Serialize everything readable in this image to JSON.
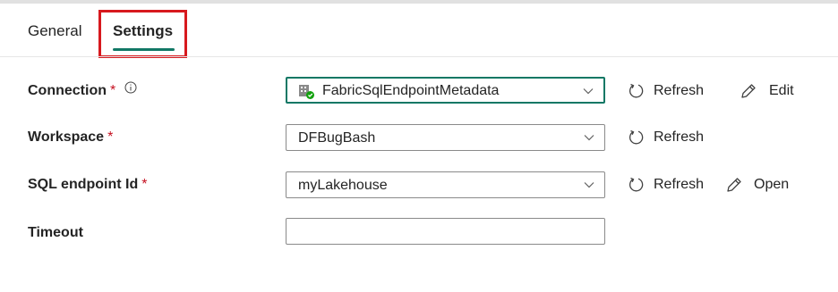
{
  "tabs": {
    "general": "General",
    "settings": "Settings"
  },
  "form": {
    "connection": {
      "label": "Connection",
      "required_mark": "*",
      "value": "FabricSqlEndpointMetadata",
      "refresh": "Refresh",
      "edit": "Edit"
    },
    "workspace": {
      "label": "Workspace",
      "required_mark": "*",
      "value": "DFBugBash",
      "refresh": "Refresh"
    },
    "sql_endpoint": {
      "label": "SQL endpoint Id",
      "required_mark": "*",
      "value": "myLakehouse",
      "refresh": "Refresh",
      "open": "Open"
    },
    "timeout": {
      "label": "Timeout",
      "value": ""
    }
  },
  "colors": {
    "accent": "#117865",
    "highlight": "#d7191e",
    "required": "#c50f1f"
  }
}
